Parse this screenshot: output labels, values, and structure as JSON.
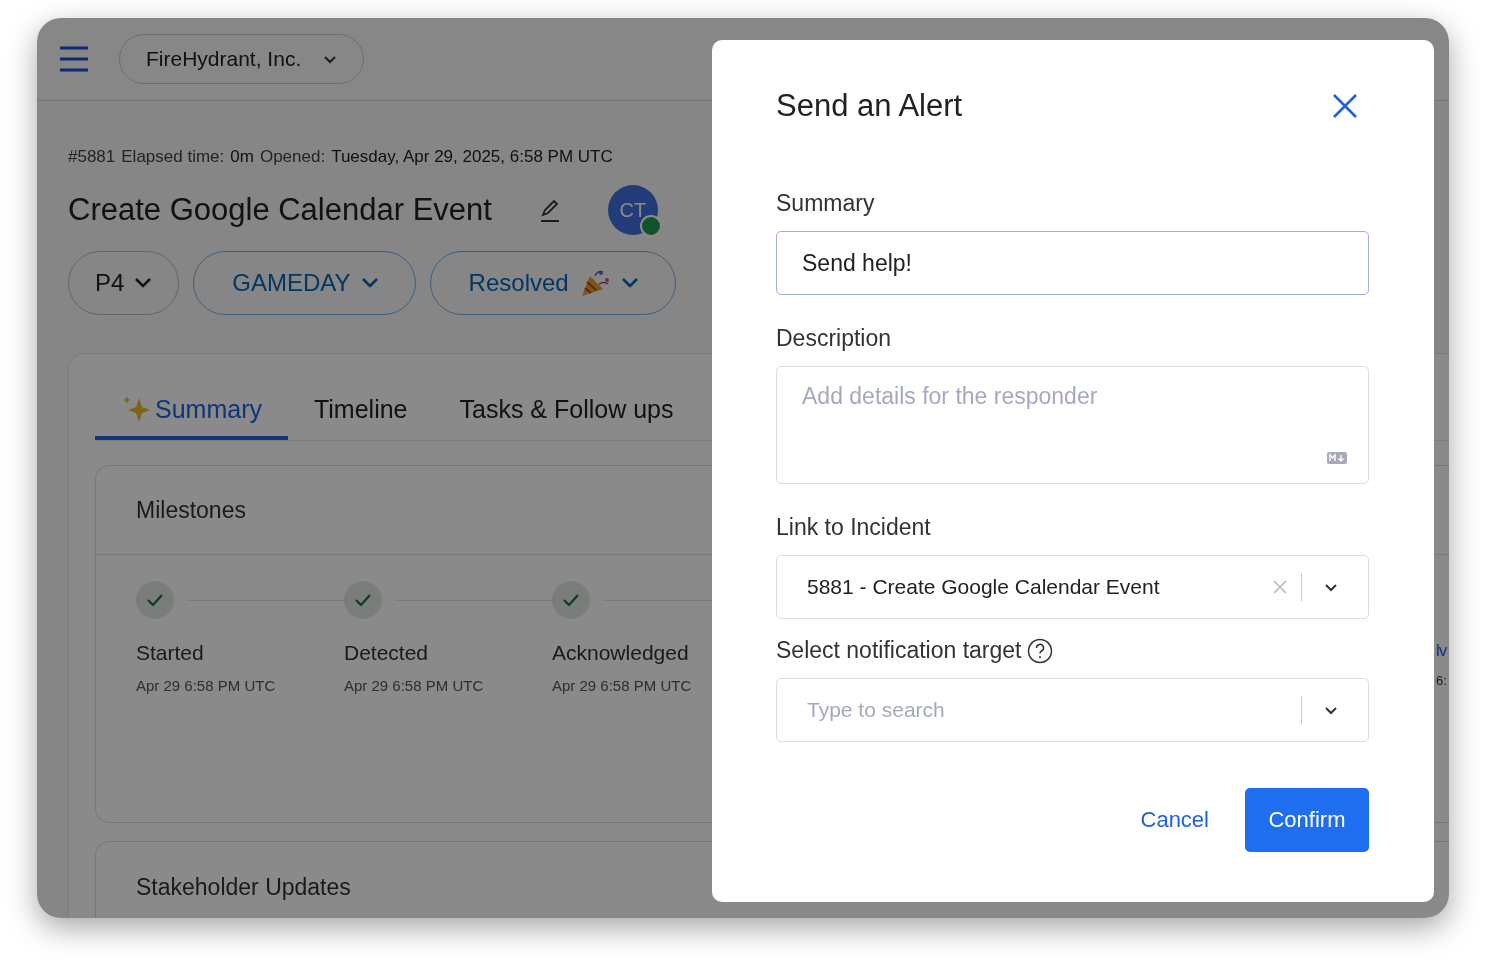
{
  "topbar": {
    "org": "FireHydrant, Inc."
  },
  "incident": {
    "meta": [
      "#5881",
      "Elapsed time:",
      "0m",
      "Opened:",
      "Tuesday, Apr 29, 2025, 6:58 PM UTC"
    ],
    "title": "Create Google Calendar Event",
    "avatar": "CT",
    "chips": [
      {
        "label": "P4",
        "kind": "plain"
      },
      {
        "label": "GAMEDAY",
        "kind": "accent"
      },
      {
        "label": "Resolved",
        "kind": "celebrate"
      }
    ]
  },
  "tabs": [
    {
      "label": "Summary",
      "selected": true
    },
    {
      "label": "Timeline",
      "selected": false
    },
    {
      "label": "Tasks & Follow ups",
      "selected": false
    }
  ],
  "milestones_card": {
    "title": "Milestones",
    "items": [
      {
        "label": "Started",
        "time": "Apr 29 6:58 PM UTC",
        "done": true
      },
      {
        "label": "Detected",
        "time": "Apr 29 6:58 PM UTC",
        "done": true
      },
      {
        "label": "Acknowledged",
        "time": "Apr 29 6:58 PM UTC",
        "done": true
      }
    ],
    "cut_item": {
      "label": "lv",
      "time": "6:"
    }
  },
  "stakeholder_card": {
    "title": "Stakeholder Updates"
  },
  "modal": {
    "title": "Send an Alert",
    "summary": {
      "label": "Summary",
      "value": "Send help!"
    },
    "description": {
      "label": "Description",
      "placeholder": "Add details for the responder"
    },
    "incident_link": {
      "label": "Link to Incident",
      "value": "5881 - Create Google Calendar Event"
    },
    "target": {
      "label": "Select notification target",
      "placeholder": "Type to search"
    },
    "cancel": "Cancel",
    "confirm": "Confirm"
  }
}
